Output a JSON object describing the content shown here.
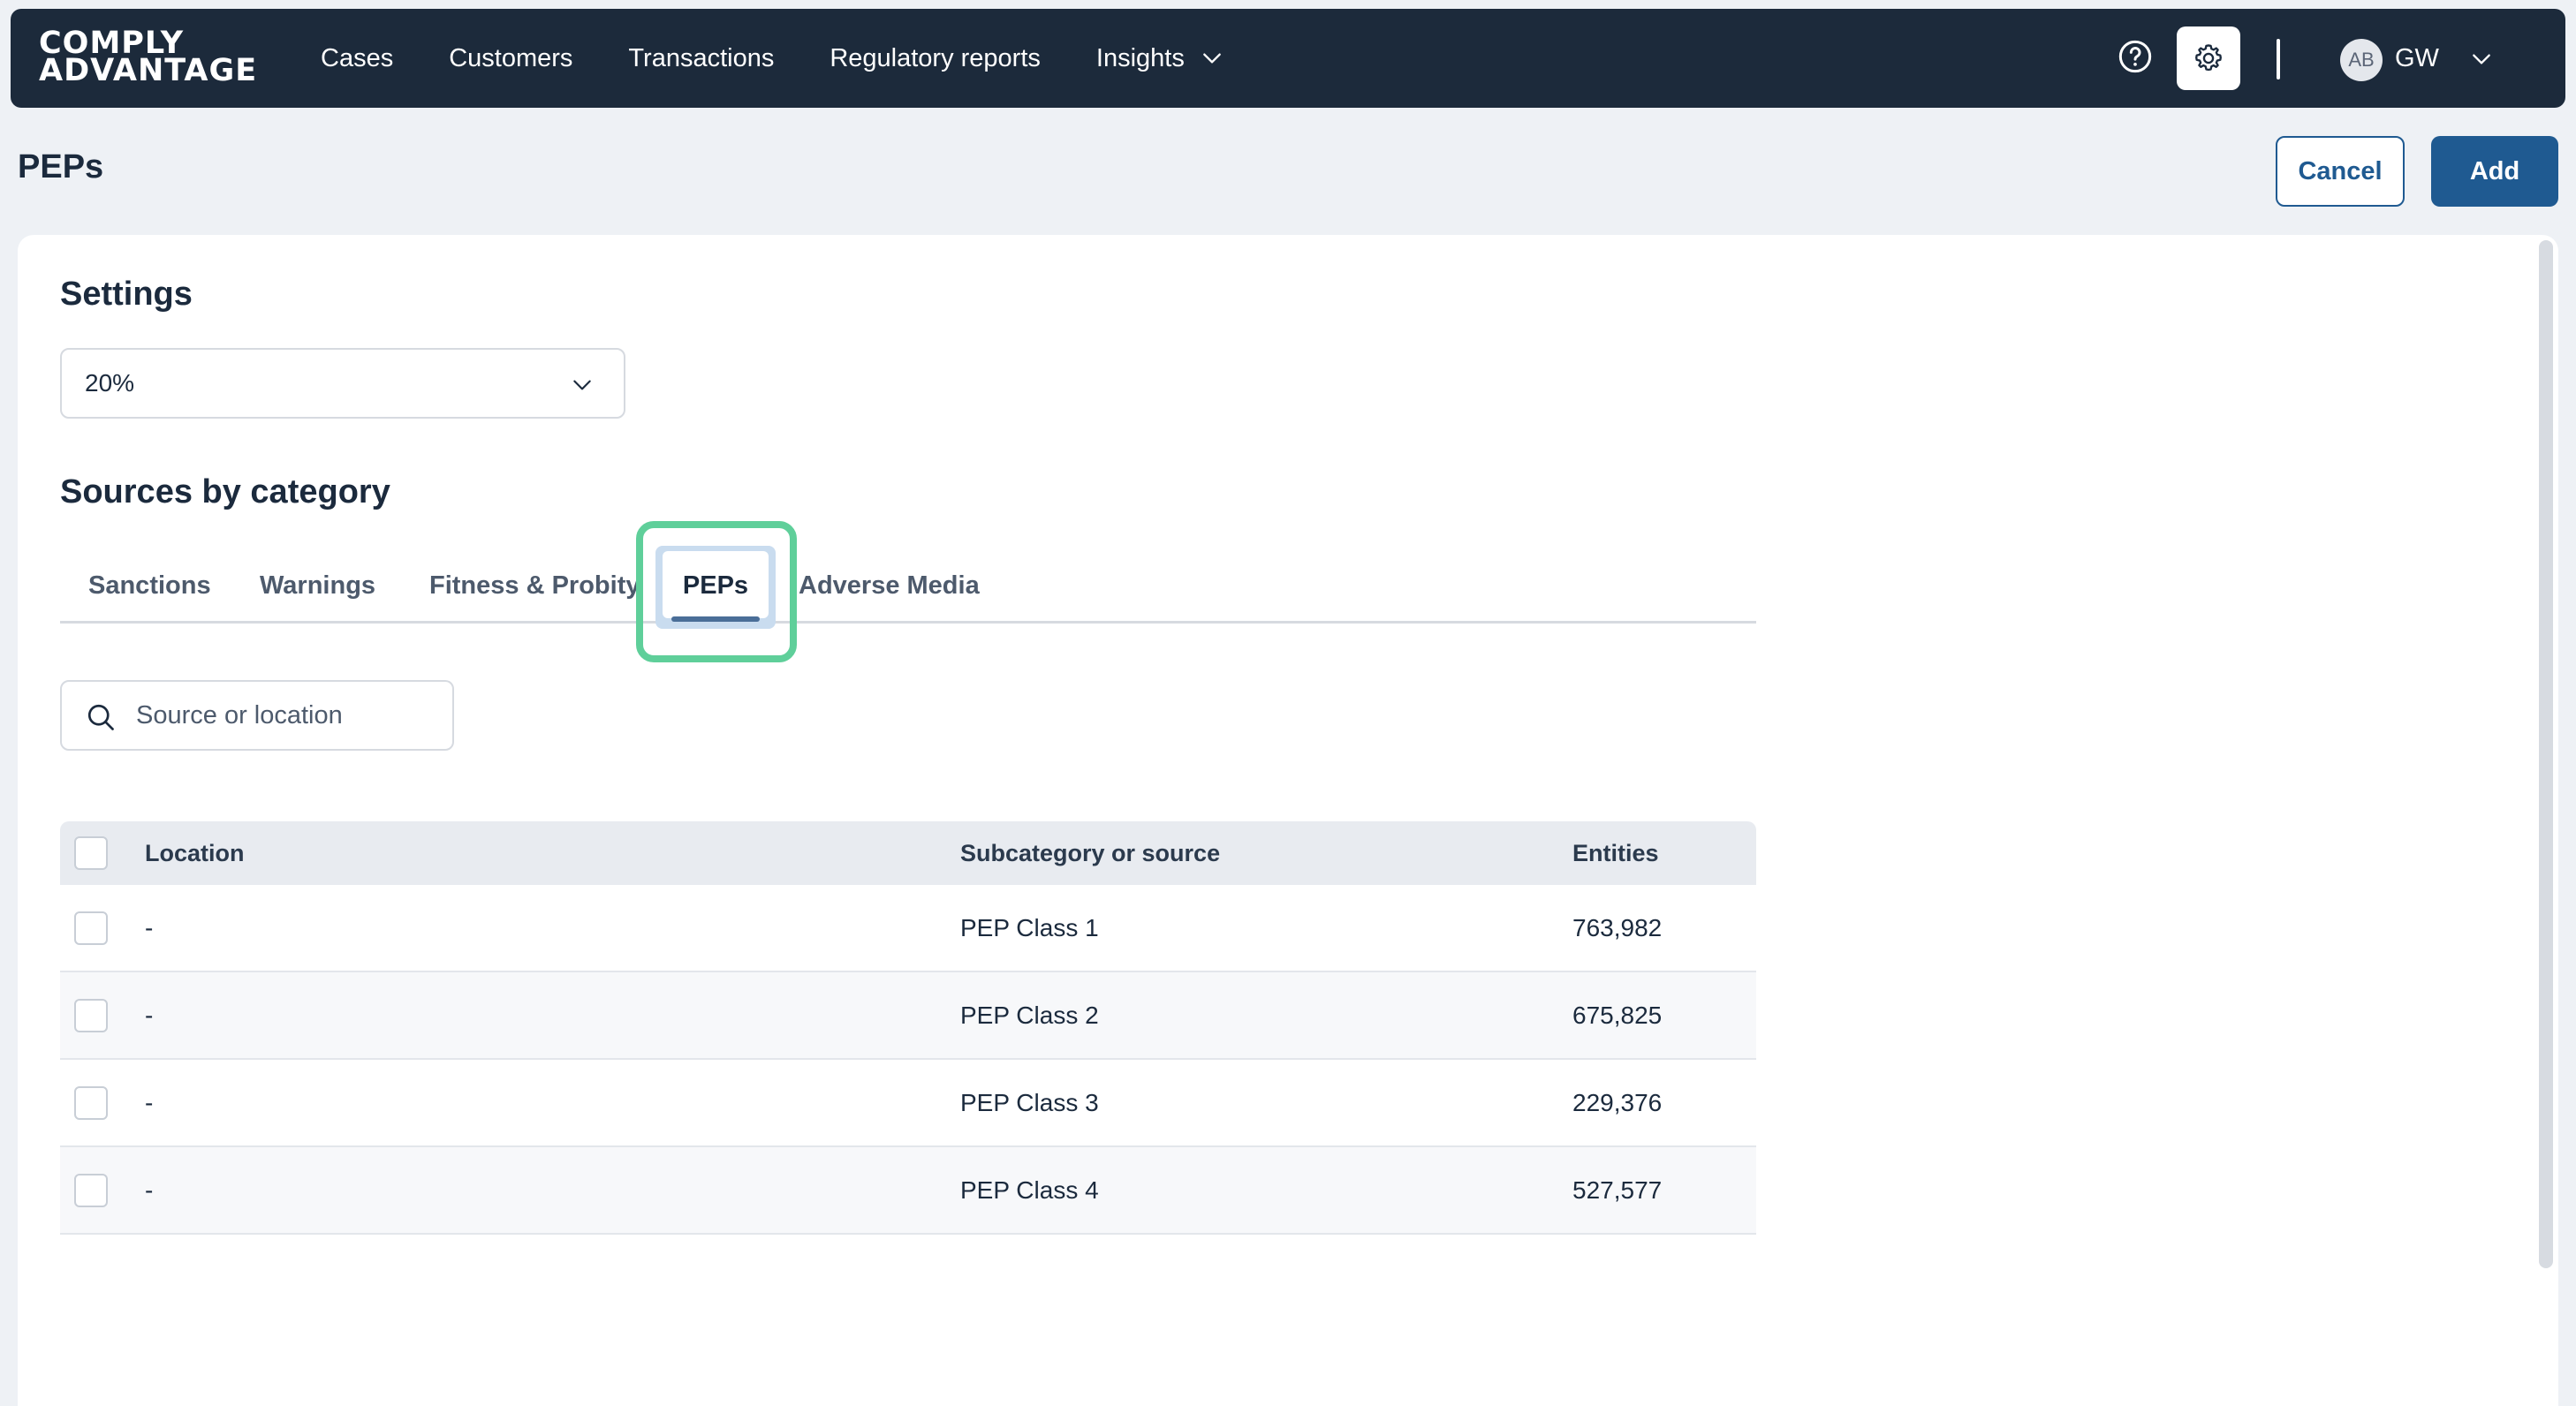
{
  "brand": {
    "line1": "COMPLY",
    "line2": "ADVANTAGE"
  },
  "nav": {
    "links": [
      {
        "label": "Cases"
      },
      {
        "label": "Customers"
      },
      {
        "label": "Transactions"
      },
      {
        "label": "Regulatory reports"
      },
      {
        "label": "Insights",
        "has_dropdown": true
      }
    ],
    "icons": {
      "help": "help-circle-icon",
      "settings": "gear-icon",
      "user_menu": "chevron-down-icon"
    },
    "avatar": "AB",
    "user_initials": "GW"
  },
  "page": {
    "title": "PEPs",
    "cancel_label": "Cancel",
    "add_label": "Add"
  },
  "settings": {
    "title": "Settings",
    "threshold_value": "20%"
  },
  "sources": {
    "title": "Sources by category",
    "tabs": [
      {
        "label": "Sanctions"
      },
      {
        "label": "Warnings"
      },
      {
        "label": "Fitness & Probity"
      },
      {
        "label": "PEPs",
        "active": true
      },
      {
        "label": "Adverse Media"
      }
    ],
    "search_placeholder": "Source or location"
  },
  "table": {
    "headers": {
      "location": "Location",
      "subcategory": "Subcategory or source",
      "entities": "Entities"
    },
    "rows": [
      {
        "location": "-",
        "subcategory": "PEP Class 1",
        "entities": "763,982"
      },
      {
        "location": "-",
        "subcategory": "PEP Class 2",
        "entities": "675,825"
      },
      {
        "location": "-",
        "subcategory": "PEP Class 3",
        "entities": "229,376"
      },
      {
        "location": "-",
        "subcategory": "PEP Class 4",
        "entities": "527,577"
      }
    ]
  },
  "colors": {
    "nav_bg": "#1c2a3b",
    "primary": "#1f5a91",
    "highlight": "#5fcf9a"
  }
}
